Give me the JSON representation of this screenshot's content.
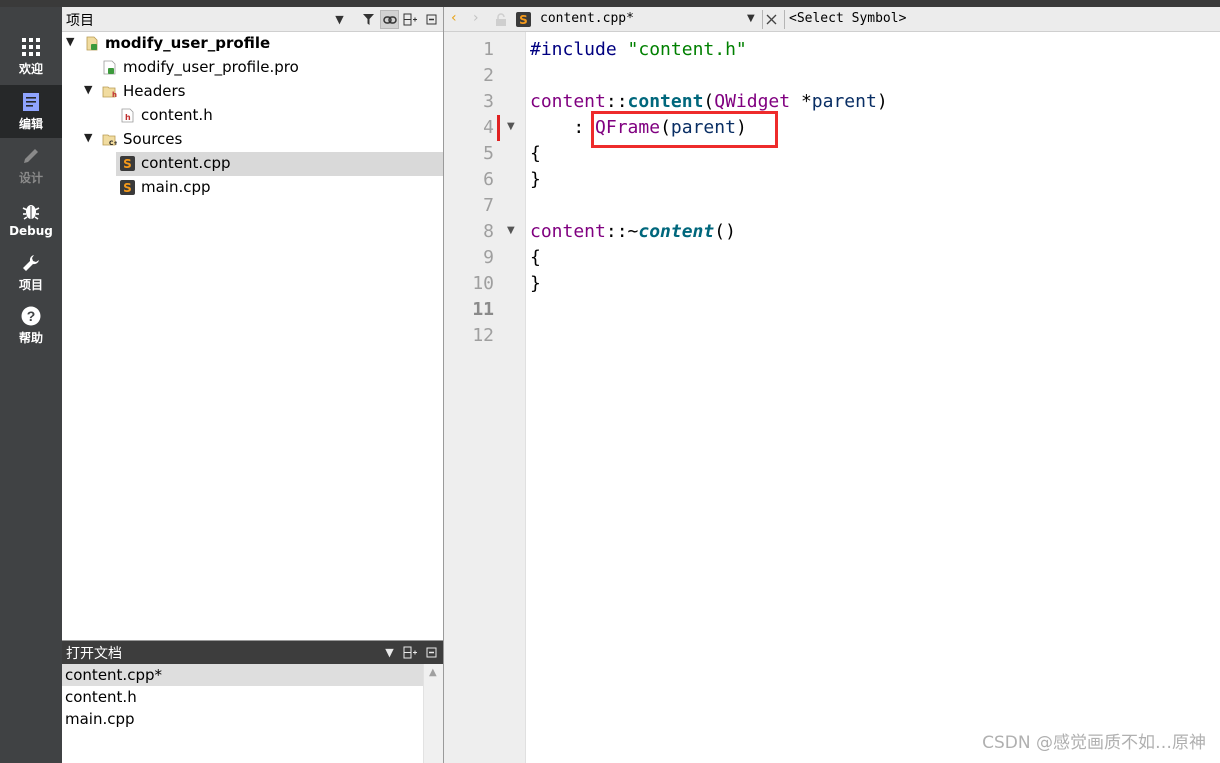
{
  "modes": [
    {
      "label": "欢迎",
      "icon": "grid-icon",
      "state": "normal"
    },
    {
      "label": "编辑",
      "icon": "edit-document-icon",
      "state": "active"
    },
    {
      "label": "设计",
      "icon": "pencil-icon",
      "state": "disabled"
    },
    {
      "label": "Debug",
      "icon": "bug-icon",
      "state": "normal"
    },
    {
      "label": "项目",
      "icon": "wrench-icon",
      "state": "normal"
    },
    {
      "label": "帮助",
      "icon": "help-icon",
      "state": "normal"
    }
  ],
  "project_panel": {
    "title": "项目",
    "tree": [
      {
        "label": "modify_user_profile",
        "kind": "project"
      },
      {
        "label": "modify_user_profile.pro",
        "kind": "pro-file"
      },
      {
        "label": "Headers",
        "kind": "folder"
      },
      {
        "label": "content.h",
        "kind": "header-file"
      },
      {
        "label": "Sources",
        "kind": "folder"
      },
      {
        "label": "content.cpp",
        "kind": "source-file"
      },
      {
        "label": "main.cpp",
        "kind": "source-file"
      }
    ]
  },
  "open_documents": {
    "title": "打开文档",
    "items": [
      "content.cpp*",
      "content.h",
      "main.cpp"
    ]
  },
  "editor": {
    "file_name": "content.cpp*",
    "symbol_placeholder": "<Select Symbol>",
    "line_numbers": [
      "1",
      "2",
      "3",
      "4",
      "5",
      "6",
      "7",
      "8",
      "9",
      "10",
      "11",
      "12"
    ],
    "current_line": "11",
    "code": {
      "l1_directive": "#include",
      "l1_header": "\"content.h\"",
      "l3_class": "content",
      "l3_scope": "::",
      "l3_ctor": "content",
      "l3_open": "(",
      "l3_type": "QWidget",
      "l3_ptr": " *",
      "l3_param": "parent",
      "l3_close": ")",
      "l4_colon": "    : ",
      "l4_base": "QFrame",
      "l4_open": "(",
      "l4_arg": "parent",
      "l4_close": ")",
      "l5": "{",
      "l6": "}",
      "l8_class": "content",
      "l8_scope": "::~",
      "l8_dtor": "content",
      "l8_parens": "()",
      "l9": "{",
      "l10": "}"
    }
  },
  "watermark": "CSDN @感觉画质不如…原神",
  "colors": {
    "modebar": "#404244",
    "highlight_box": "#ee2b2b",
    "keyword_class": "#800080",
    "function": "#00677c",
    "string": "#008000"
  }
}
